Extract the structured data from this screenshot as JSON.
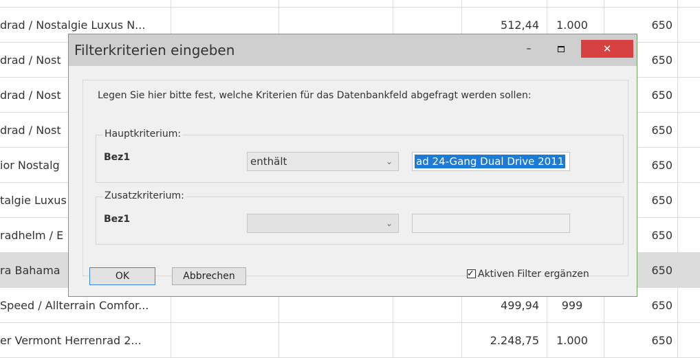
{
  "grid": {
    "rows": [
      {
        "name": "drad / Nostalgie Luxus N...",
        "price": "512,44",
        "qty": "1.000",
        "val": "650"
      },
      {
        "name": "drad / Nost",
        "price": "",
        "qty": "",
        "val": "650"
      },
      {
        "name": "drad / Nost",
        "price": "",
        "qty": "",
        "val": "650"
      },
      {
        "name": "drad / Nost",
        "price": "",
        "qty": "",
        "val": "650"
      },
      {
        "name": "ior Nostalg",
        "price": "",
        "qty": "",
        "val": "650"
      },
      {
        "name": "talgie Luxus",
        "price": "",
        "qty": "",
        "val": "650"
      },
      {
        "name": "radhelm / E",
        "price": "",
        "qty": "",
        "val": "650"
      },
      {
        "name": "ra Bahama",
        "price": "",
        "qty": "",
        "val": "650"
      },
      {
        "name": "Speed / Allterrain Comfor...",
        "price": "499,94",
        "qty": "999",
        "val": "650"
      },
      {
        "name": "er Vermont Herrenrad 2...",
        "price": "2.248,75",
        "qty": "1.000",
        "val": "650"
      }
    ]
  },
  "dialog": {
    "title": "Filterkriterien eingeben",
    "minimize": "–",
    "close": "✕",
    "intro": "Legen Sie hier bitte fest, welche Kriterien für das Datenbankfeld abgefragt werden sollen:",
    "main": {
      "label": "Hauptkriterium:",
      "field": "Bez1",
      "operator": "enthält",
      "value": "ad 24-Gang Dual Drive 2011"
    },
    "extra": {
      "label": "Zusatzkriterium:",
      "field": "Bez1",
      "operator": "",
      "value": ""
    },
    "ok_label": "OK",
    "cancel_label": "Abbrechen",
    "checkbox_label": "Aktiven Filter ergänzen",
    "checkbox_checked": true
  },
  "colors": {
    "dialog_border": "#6da45d",
    "titlebar": "#cfcfcf",
    "close_button": "#d74141",
    "selection": "#1c7bd6"
  }
}
